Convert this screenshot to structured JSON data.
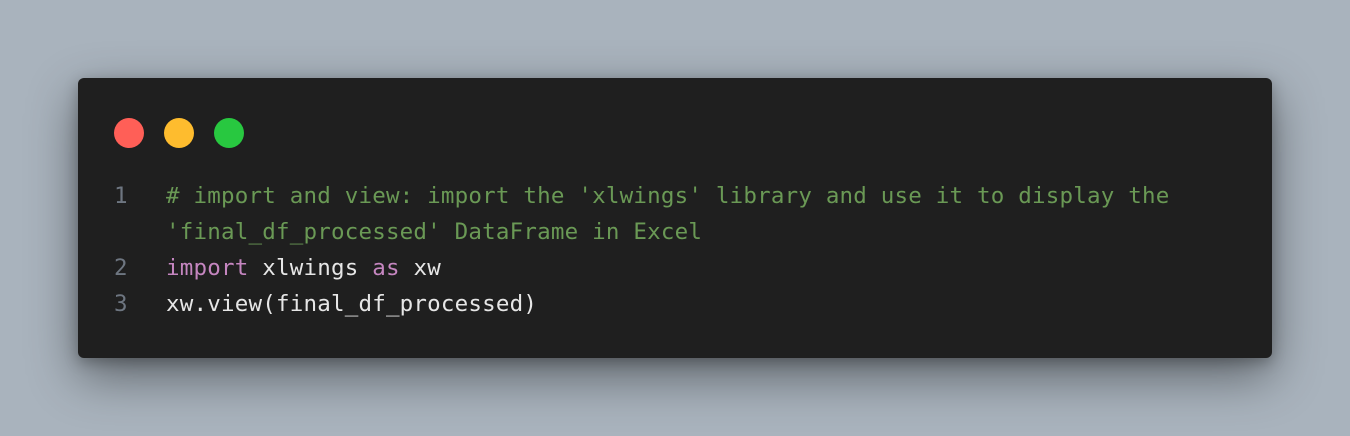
{
  "colors": {
    "background": "#a9b3bd",
    "panel": "#1f1f1f",
    "dot_red": "#ff5f57",
    "dot_yellow": "#febc2e",
    "dot_green": "#28c840",
    "comment": "#6a9955",
    "keyword": "#c586c0",
    "text": "#e6e6e6",
    "line_number": "#6e7681"
  },
  "window": {
    "controls": [
      "close",
      "minimize",
      "maximize"
    ]
  },
  "code": {
    "lines": [
      {
        "number": "1",
        "comment": "# import and view: import the 'xlwings' library and use it to display the 'final_df_processed' DataFrame in Excel"
      },
      {
        "number": "2",
        "kw1": "import",
        "t1": " xlwings ",
        "kw2": "as",
        "t2": " xw"
      },
      {
        "number": "3",
        "text": "xw.view(final_df_processed)"
      }
    ]
  }
}
